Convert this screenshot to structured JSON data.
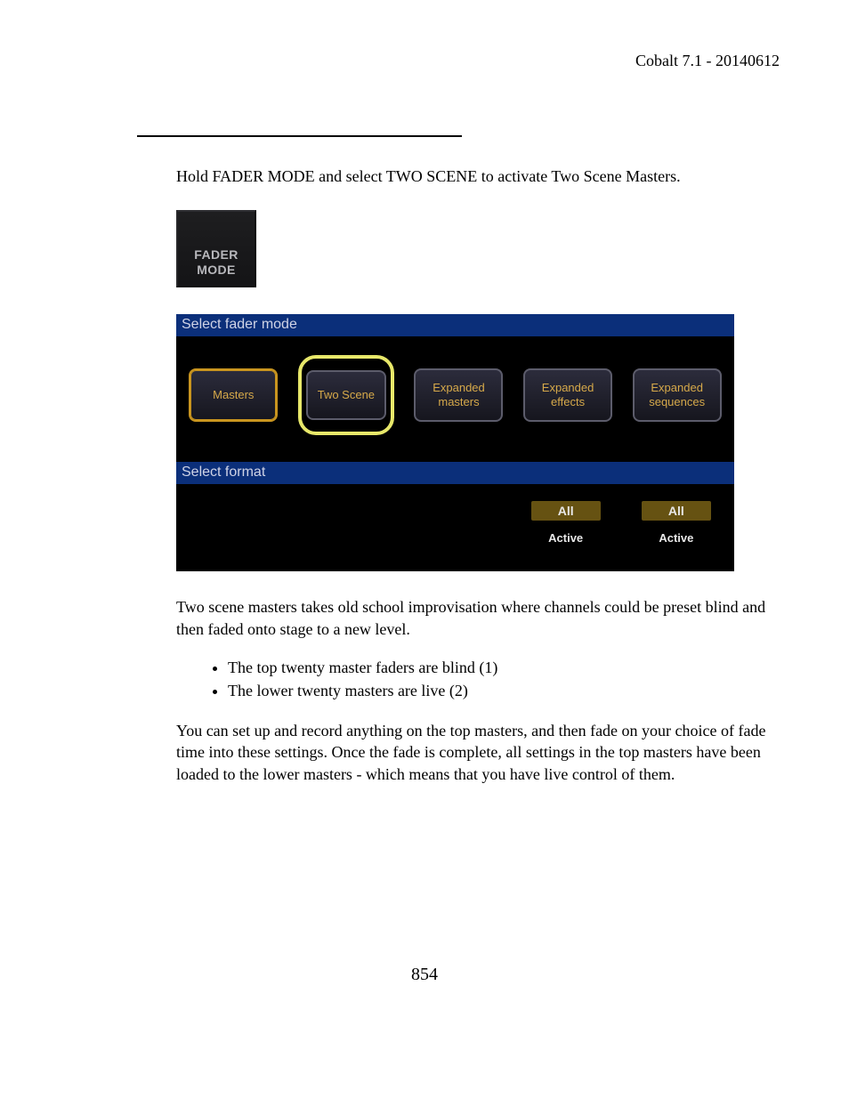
{
  "header": "Cobalt 7.1 - 20140612",
  "page_number": "854",
  "text": {
    "intro": "Hold FADER MODE and select TWO SCENE to activate Two Scene Masters.",
    "key_label_line1": "FADER",
    "key_label_line2": "MODE",
    "after_panel": "Two scene masters takes old school improvisation where channels could be preset blind and then faded onto stage to a new level.",
    "bullet1": "The top twenty master faders are blind (1)",
    "bullet2": "The lower twenty masters are live (2)",
    "final": "You can set up and record anything on the top masters, and then fade on your choice of fade time into these settings. Once the fade is complete, all settings in the top masters have been loaded to the lower masters - which means that you have live control of them."
  },
  "panel": {
    "heading_mode": "Select fader mode",
    "heading_format": "Select format",
    "modes": {
      "masters": "Masters",
      "two_scene": "Two Scene",
      "expanded_masters": "Expanded masters",
      "expanded_effects": "Expanded effects",
      "expanded_sequences": "Expanded sequences"
    },
    "format": {
      "all": "All",
      "active": "Active"
    }
  }
}
